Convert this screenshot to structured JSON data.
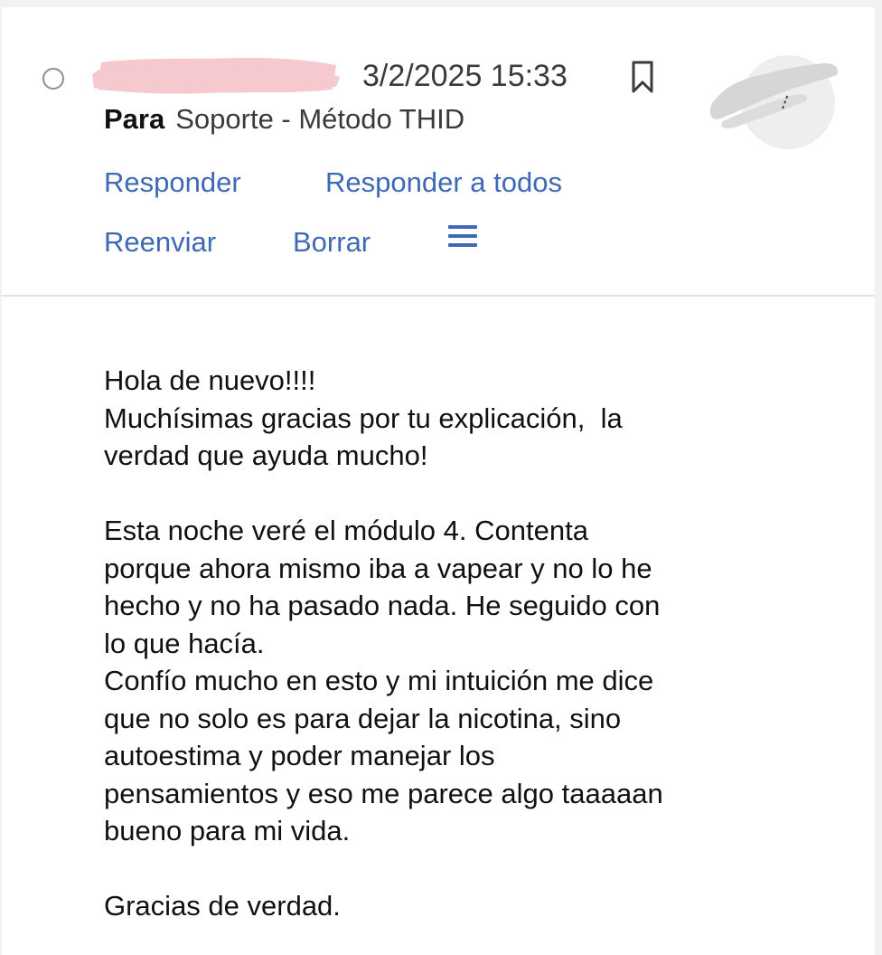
{
  "message": {
    "timestamp": "3/2/2025 15:33",
    "to_label": "Para",
    "to_value": "Soporte - Método THID"
  },
  "actions": {
    "reply": "Responder",
    "reply_all": "Responder a todos",
    "forward": "Reenviar",
    "delete": "Borrar"
  },
  "body": {
    "lines": [
      "Hola de nuevo!!!!",
      "Muchísimas gracias por tu explicación,  la",
      "verdad que ayuda mucho!",
      "",
      "Esta noche veré el módulo 4. Contenta",
      "porque ahora mismo iba a vapear y no lo he",
      "hecho y no ha pasado nada. He seguido con",
      "lo que hacía.",
      "Confío mucho en esto y mi intuición me dice",
      "que no solo es para dejar la nicotina, sino",
      "autoestima y poder manejar los",
      "pensamientos y eso me parece algo taaaaan",
      "bueno para mi vida.",
      "",
      "Gracias de verdad."
    ]
  },
  "icons": {
    "select": "circle-select-icon",
    "bookmark": "bookmark-icon",
    "menu": "hamburger-menu-icon",
    "avatar": "avatar"
  },
  "colors": {
    "accent": "#3f68b7",
    "text": "#111111",
    "muted": "#3b3b3f",
    "redaction": "#f6c9ce",
    "divider": "#e3e3e6",
    "outer_background": "#f2f2f3"
  }
}
